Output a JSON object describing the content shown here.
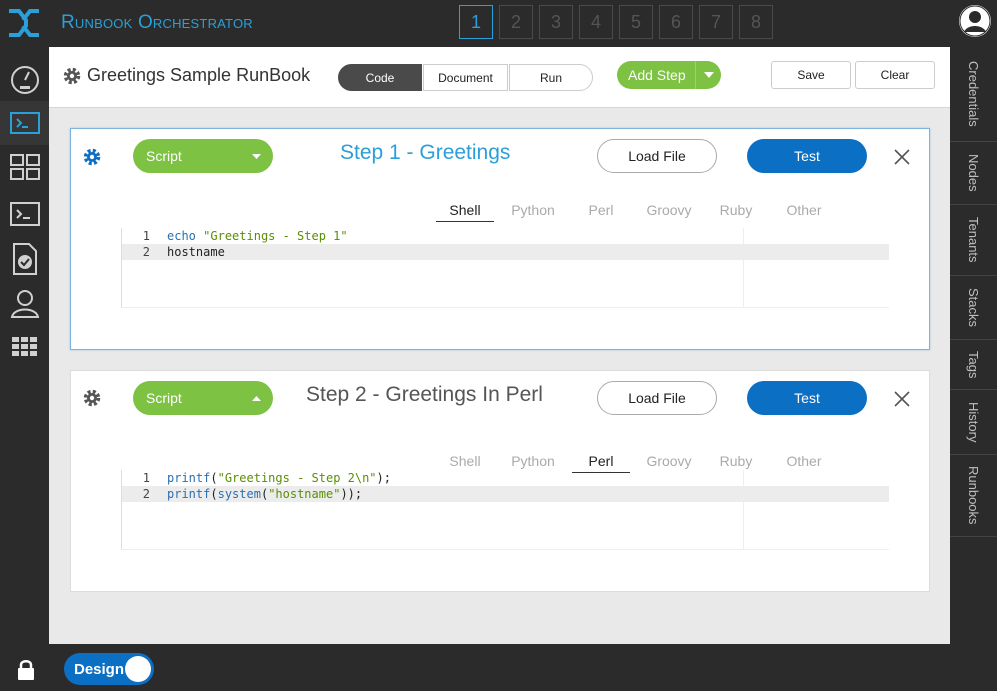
{
  "app": {
    "title": "Runbook Orchestrator",
    "pages": [
      "1",
      "2",
      "3",
      "4",
      "5",
      "6",
      "7",
      "8"
    ],
    "active_page": "1"
  },
  "left_nav": [
    {
      "icon": "dashboard-gauge-icon"
    },
    {
      "icon": "terminal-small-icon",
      "active": true
    },
    {
      "icon": "grid-arrows-icon"
    },
    {
      "icon": "console-icon"
    },
    {
      "icon": "document-check-icon"
    },
    {
      "icon": "user-icon"
    },
    {
      "icon": "apps-grid-icon"
    }
  ],
  "right_tabs": [
    "Credentials",
    "Nodes",
    "Tenants",
    "Stacks",
    "Tags",
    "History",
    "Runbooks"
  ],
  "toolbar": {
    "title": "Greetings Sample RunBook",
    "mode_tabs": [
      "Code",
      "Document",
      "Run"
    ],
    "active_mode": "Code",
    "add_step_label": "Add Step",
    "save_label": "Save",
    "clear_label": "Clear"
  },
  "steps": [
    {
      "type_label": "Script",
      "title": "Step 1 - Greetings",
      "load_file_label": "Load File",
      "test_label": "Test",
      "languages": [
        "Shell",
        "Python",
        "Perl",
        "Groovy",
        "Ruby",
        "Other"
      ],
      "active_language": "Shell",
      "code_lines": [
        {
          "num": "1",
          "text": "echo \"Greetings - Step 1\""
        },
        {
          "num": "2",
          "text": "hostname"
        }
      ]
    },
    {
      "type_label": "Script",
      "title": "Step 2 - Greetings In Perl",
      "load_file_label": "Load File",
      "test_label": "Test",
      "languages": [
        "Shell",
        "Python",
        "Perl",
        "Groovy",
        "Ruby",
        "Other"
      ],
      "active_language": "Perl",
      "code_lines": [
        {
          "num": "1",
          "text": "printf(\"Greetings - Step 2\\n\");"
        },
        {
          "num": "2",
          "text": "printf(system(\"hostname\"));"
        }
      ]
    }
  ],
  "footer": {
    "design_label": "Design"
  },
  "colors": {
    "accent_blue": "#2a9fd8",
    "green": "#7dc242",
    "button_blue": "#0b6fc4",
    "dark": "#2b2b2b"
  }
}
